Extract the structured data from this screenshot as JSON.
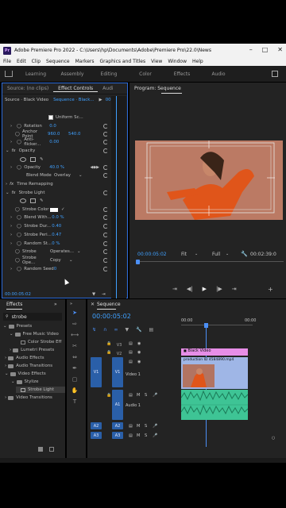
{
  "app": {
    "title": "Adobe Premiere Pro 2022 - C:\\Users\\hp\\Documents\\Adobe\\Premiere Pro\\22.0\\News Paper Visualiza...",
    "logo": "Pr"
  },
  "menu": [
    "File",
    "Edit",
    "Clip",
    "Sequence",
    "Markers",
    "Graphics and Titles",
    "View",
    "Window",
    "Help"
  ],
  "workspaces": [
    "Learning",
    "Assembly",
    "Editing",
    "Color",
    "Effects",
    "Audio"
  ],
  "effect_controls": {
    "tab_source": "Source: (no clips)",
    "tab_ec": "Effect Controls",
    "tab_audio": "Audi",
    "source_label": "Source · Black Video",
    "sequence_label": "Sequence · Black...",
    "time_header": "00",
    "uniform_scale": "Uniform Sc...",
    "rows": [
      {
        "name": "Rotation",
        "value": "0.0"
      },
      {
        "name": "Anchor Point",
        "value": "960.0",
        "value2": "540.0"
      },
      {
        "name": "Anti-flicker...",
        "value": "0.00"
      }
    ],
    "opacity_group": "Opacity",
    "opacity_label": "Opacity",
    "opacity_value": "40.0 %",
    "blend_label": "Blend Mode",
    "blend_value": "Overlay",
    "time_remap": "Time Remapping",
    "strobe_group": "Strobe Light",
    "strobe_rows": [
      {
        "name": "Strobe Color",
        "value": ""
      },
      {
        "name": "Blend With...",
        "value": "0.0 %"
      },
      {
        "name": "Strobe Dur...",
        "value": "0.40"
      },
      {
        "name": "Strobe Peri...",
        "value": "0.47"
      },
      {
        "name": "Random St...",
        "value": "0 %"
      },
      {
        "name": "Strobe",
        "value": "Operates..."
      },
      {
        "name": "Strobe Ope...",
        "value": "Copy"
      },
      {
        "name": "Random Seed",
        "value": "0"
      }
    ],
    "timecode": "00:00:05:02"
  },
  "program": {
    "title": "Program: Sequence",
    "timecode": "00:00:05:02",
    "fit": "Fit",
    "quality": "Full",
    "duration": "00:02:39:0"
  },
  "effects_panel": {
    "tab": "Effects",
    "search_value": "strobe",
    "tree": [
      "Presets",
      "Free Music Video",
      "Color Strobe Eff",
      "Lumetri Presets",
      "Audio Effects",
      "Audio Transitions",
      "Video Effects",
      "Stylize",
      "Strobe Light",
      "Video Transitions"
    ]
  },
  "sequence": {
    "tab": "Sequence",
    "timecode": "00:00:05:02",
    "ruler_start": "00:00",
    "ruler_end": "00:00",
    "tracks": {
      "v3": "V3",
      "v2": "V2",
      "v1": "V1",
      "v1_src": "V1",
      "v1_name": "Video 1",
      "a1": "A1",
      "a1_src": "A1",
      "a1_name": "Audio 1",
      "a2": "A2",
      "a2_src": "A2",
      "a3": "A3",
      "a3_src": "A3"
    },
    "clip_black": "Black Video",
    "clip_video": "production ID 4584890.mp4",
    "toggle_m": "M",
    "toggle_s": "S"
  },
  "colors": {
    "accent": "#2d6bd8",
    "timecode": "#3fa0ff",
    "clip_pink": "#e78ee7",
    "clip_video": "#9fb6e6",
    "clip_audio": "#3ec495",
    "playhead": "#4c8ff5"
  }
}
